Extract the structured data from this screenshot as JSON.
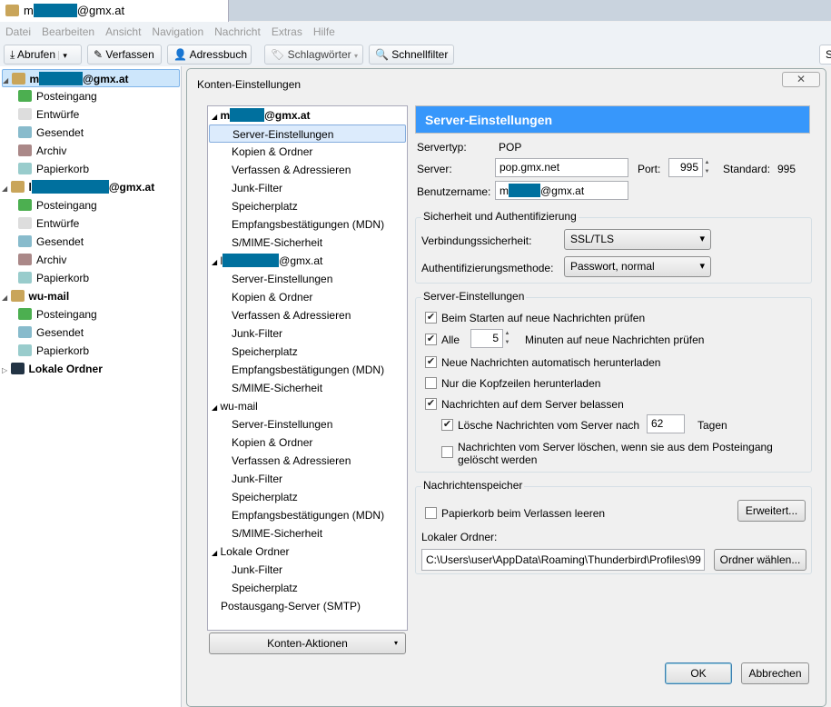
{
  "window": {
    "tab_prefix": "m",
    "tab_suffix": "@gmx.at"
  },
  "menu": [
    "Datei",
    "Bearbeiten",
    "Ansicht",
    "Navigation",
    "Nachricht",
    "Extras",
    "Hilfe"
  ],
  "toolbar": {
    "get": "Abrufen",
    "write": "Verfassen",
    "addressbook": "Adressbuch",
    "tags": "Schlagwörter",
    "quickfilter": "Schnellfilter"
  },
  "folders": [
    {
      "type": "acc",
      "prefix": "m",
      "suffix": "@gmx.at",
      "selected": true
    },
    {
      "label": "Posteingang",
      "icon": "inbox"
    },
    {
      "label": "Entwürfe",
      "icon": "drafts"
    },
    {
      "label": "Gesendet",
      "icon": "sent"
    },
    {
      "label": "Archiv",
      "icon": "archive"
    },
    {
      "label": "Papierkorb",
      "icon": "trash"
    },
    {
      "type": "acc",
      "prefix": "l",
      "suffix": "@gmx.at"
    },
    {
      "label": "Posteingang",
      "icon": "inbox"
    },
    {
      "label": "Entwürfe",
      "icon": "drafts"
    },
    {
      "label": "Gesendet",
      "icon": "sent"
    },
    {
      "label": "Archiv",
      "icon": "archive"
    },
    {
      "label": "Papierkorb",
      "icon": "trash"
    },
    {
      "type": "acc",
      "label": "wu-mail"
    },
    {
      "label": "Posteingang",
      "icon": "inbox"
    },
    {
      "label": "Gesendet",
      "icon": "sent"
    },
    {
      "label": "Papierkorb",
      "icon": "trash"
    },
    {
      "type": "acc",
      "label": "Lokale Ordner",
      "icon": "local"
    }
  ],
  "dialog": {
    "title": "Konten-Einstellungen",
    "close": "✕",
    "tree": [
      {
        "acc": true,
        "prefix": "m",
        "suffix": "@gmx.at"
      },
      {
        "label": "Server-Einstellungen",
        "selected": true
      },
      {
        "label": "Kopien & Ordner"
      },
      {
        "label": "Verfassen & Adressieren"
      },
      {
        "label": "Junk-Filter"
      },
      {
        "label": "Speicherplatz"
      },
      {
        "label": "Empfangsbestätigungen (MDN)"
      },
      {
        "label": "S/MIME-Sicherheit"
      },
      {
        "acc": true,
        "prefix": "l",
        "suffix": "@gmx.at"
      },
      {
        "label": "Server-Einstellungen"
      },
      {
        "label": "Kopien & Ordner"
      },
      {
        "label": "Verfassen & Adressieren"
      },
      {
        "label": "Junk-Filter"
      },
      {
        "label": "Speicherplatz"
      },
      {
        "label": "Empfangsbestätigungen (MDN)"
      },
      {
        "label": "S/MIME-Sicherheit"
      },
      {
        "acc": true,
        "label": "wu-mail"
      },
      {
        "label": "Server-Einstellungen"
      },
      {
        "label": "Kopien & Ordner"
      },
      {
        "label": "Verfassen & Adressieren"
      },
      {
        "label": "Junk-Filter"
      },
      {
        "label": "Speicherplatz"
      },
      {
        "label": "Empfangsbestätigungen (MDN)"
      },
      {
        "label": "S/MIME-Sicherheit"
      },
      {
        "acc": true,
        "label": "Lokale Ordner"
      },
      {
        "label": "Junk-Filter"
      },
      {
        "label": "Speicherplatz"
      },
      {
        "acc": true,
        "nochev": true,
        "label": "Postausgang-Server (SMTP)"
      }
    ],
    "account_actions": "Konten-Aktionen",
    "header": "Server-Einstellungen",
    "servertype_label": "Servertyp:",
    "servertype": "POP",
    "server_label": "Server:",
    "server": "pop.gmx.net",
    "port_label": "Port:",
    "port": "995",
    "standard_label": "Standard:",
    "standard": "995",
    "user_label": "Benutzername:",
    "user_prefix": "m",
    "user_suffix": "@gmx.at",
    "security": {
      "title": "Sicherheit und Authentifizierung",
      "conn_label": "Verbindungssicherheit:",
      "conn": "SSL/TLS",
      "auth_label": "Authentifizierungsmethode:",
      "auth": "Passwort, normal"
    },
    "server_settings": {
      "title": "Server-Einstellungen",
      "check_start": "Beim Starten auf neue Nachrichten prüfen",
      "check_start_on": true,
      "every": "Alle",
      "minutes": "5",
      "minutes_label": "Minuten auf neue Nachrichten prüfen",
      "every_on": true,
      "auto_download": "Neue Nachrichten automatisch herunterladen",
      "auto_download_on": true,
      "headers_only": "Nur die Kopfzeilen herunterladen",
      "headers_only_on": false,
      "leave": "Nachrichten auf dem Server belassen",
      "leave_on": true,
      "delete_after": "Lösche Nachrichten vom Server nach",
      "days": "62",
      "days_label": "Tagen",
      "delete_after_on": true,
      "delete_inbox": "Nachrichten vom Server löschen, wenn sie aus dem Posteingang gelöscht werden",
      "delete_inbox_on": false
    },
    "storage": {
      "title": "Nachrichtenspeicher",
      "empty_trash": "Papierkorb beim Verlassen leeren",
      "empty_trash_on": false,
      "advanced": "Erweitert...",
      "local_label": "Lokaler Ordner:",
      "local_path": "C:\\Users\\user\\AppData\\Roaming\\Thunderbird\\Profiles\\99",
      "choose": "Ordner wählen..."
    },
    "ok": "OK",
    "cancel": "Abbrechen"
  },
  "colors": {
    "accent": "#3797fb",
    "redaction": "#00709e"
  }
}
